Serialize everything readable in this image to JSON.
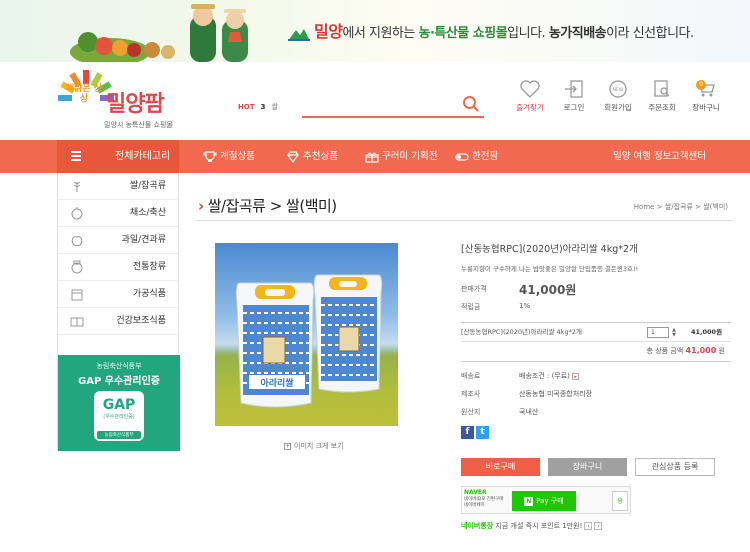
{
  "banner": {
    "brand": "밀양",
    "text1": "에서 지원하는 ",
    "text2": "농·특산물 쇼핑몰",
    "text3": "입니다. ",
    "text4": "농가직배송",
    "text5": "이라 신선합니다."
  },
  "logo": {
    "slogan": "해맑은 상상",
    "name": "밀양팜",
    "subtitle": "밀양시 농특산물 쇼핑몰"
  },
  "hot": {
    "label": "HOT",
    "number": "3",
    "keyword": "쌀"
  },
  "search": {
    "placeholder": ""
  },
  "header_icons": [
    {
      "label": "즐겨찾기",
      "icon": "heart-icon"
    },
    {
      "label": "로그인",
      "icon": "login-icon"
    },
    {
      "label": "회원가입",
      "icon": "new-member-icon"
    },
    {
      "label": "주문조회",
      "icon": "order-search-icon"
    },
    {
      "label": "장바구니",
      "icon": "cart-icon",
      "badge": "0"
    }
  ],
  "nav": {
    "all_categories": "전체카테고리",
    "items": [
      "계절상품",
      "추천상품",
      "꾸러미 기획전",
      "한전팜"
    ],
    "right": [
      "밀양 여행 정보",
      "고객센터"
    ]
  },
  "sidebar": {
    "items": [
      "쌀/잡곡류",
      "채소/축산",
      "과일/견과류",
      "전통장류",
      "가공식품",
      "건강보조식품"
    ],
    "gap": {
      "org": "농림축산식품부",
      "title": "GAP 우수관리인증",
      "mark": "GAP",
      "mark_sub": "(우수관리인증)",
      "mark_footer": "농림축산식품부"
    }
  },
  "page": {
    "title": "쌀/잡곡류 > 쌀(백미)",
    "breadcrumb": "Home > 쌀/잡곡류 > 쌀(백미)"
  },
  "product": {
    "title": "[산동농협RPC](2020년)아라리쌀 4kg*2개",
    "description": "누룽지향이 구수하게 나는 밥맛좋은 밀양쌀 단립품종 골든퀸3호!!",
    "zoom_label": "이미지 크게 보기",
    "bag_label": "아라리쌀",
    "price_label": "판매가격",
    "price": "41,000원",
    "points_label": "적립금",
    "points": "1%",
    "option_name": "[산동농협RPC](2020년)아라리쌀 4kg*2개",
    "option_qty": "1",
    "option_price": "41,000원",
    "total_label": "총 상품 금액",
    "total": "41,000",
    "total_unit": "원",
    "shipping_label": "배송료",
    "shipping": "배송조건 : (무료)",
    "maker_label": "제조사",
    "maker": "산동농협 미곡종합처리장",
    "origin_label": "원산지",
    "origin": "국내산"
  },
  "buttons": {
    "buy": "바로구매",
    "cart": "장바구니",
    "wish": "관심상품 등록"
  },
  "naver": {
    "logo": "NAVER",
    "sub1": "네이버ID로 간편구매",
    "sub2": "네이버페이",
    "pay": "Pay 구매",
    "wish": "찜",
    "point_brand": "네이버통장",
    "point_text": " 지금 개설 즉시 포인트 1만원!"
  },
  "colors": {
    "accent": "#f16a4f",
    "red": "#e4454c",
    "gap_green": "#21a67d",
    "naver": "#1ec800"
  }
}
